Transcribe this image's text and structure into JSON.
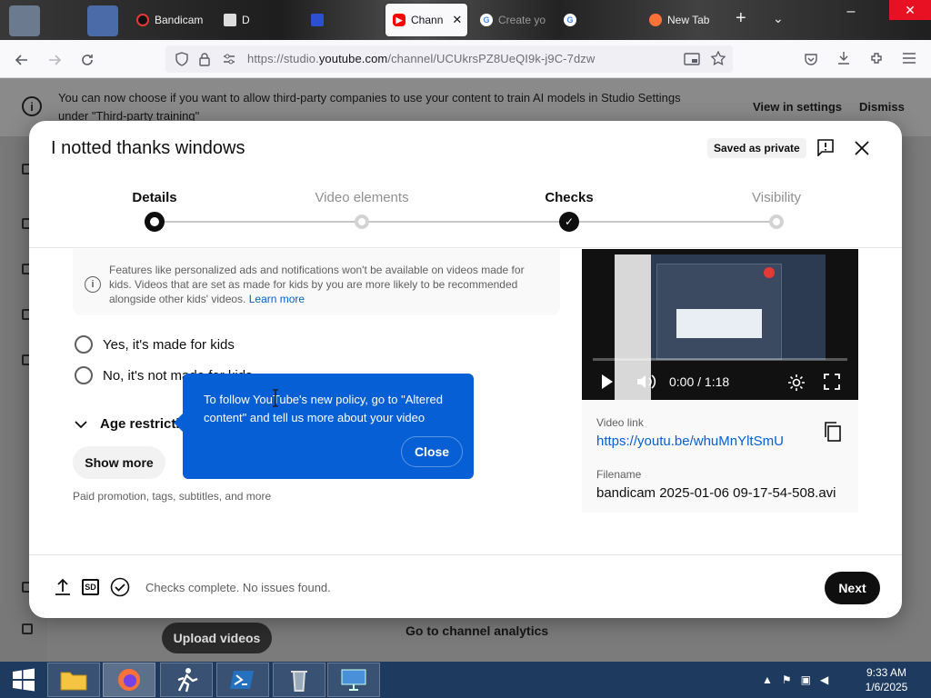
{
  "browser": {
    "tabs": [
      {
        "label": "Bandicam",
        "icon": "bandicam-icon"
      },
      {
        "label": "D",
        "icon": "document-icon"
      },
      {
        "label": "",
        "icon": "app-icon"
      },
      {
        "label": "Chann",
        "icon": "youtube-icon",
        "active": true
      },
      {
        "label": "Create yo",
        "icon": "google-icon"
      },
      {
        "label": "",
        "icon": "google-icon"
      },
      {
        "label": "New Tab",
        "icon": "firefox-icon"
      }
    ],
    "new_tab_symbol": "+",
    "tab_close_symbol": "✕",
    "url_prefix": "https://studio.",
    "url_domain": "youtube.com",
    "url_path": "/channel/UCUkrsPZ8UeQI9k-j9C-7dzw"
  },
  "page": {
    "banner_text": "You can now choose if you want to allow third-party companies to use your content to train AI models in Studio Settings under \"Third-party training\"",
    "banner_view": "View in settings",
    "banner_dismiss": "Dismiss",
    "upload_videos": "Upload videos",
    "channel_analytics": "Go to channel analytics"
  },
  "modal": {
    "title": "I notted thanks windows",
    "saved_badge": "Saved as private",
    "steps": [
      {
        "label": "Details",
        "state": "current"
      },
      {
        "label": "Video elements",
        "state": "todo"
      },
      {
        "label": "Checks",
        "state": "checked"
      },
      {
        "label": "Visibility",
        "state": "todo"
      }
    ],
    "kids_info": "Features like personalized ads and notifications won't be available on videos made for kids. Videos that are set as made for kids by you are more likely to be recommended alongside other kids' videos.",
    "learn_more": "Learn more",
    "radio_yes": "Yes, it's made for kids",
    "radio_no": "No, it's not made for kids",
    "age_restriction": "Age restriction",
    "show_more": "Show more",
    "paid_promotion": "Paid promotion, tags, subtitles, and more",
    "tooltip_text": "To follow YouTube's new policy, go to \"Altered content\" and tell us more about your video",
    "tooltip_close": "Close",
    "video_time": "0:00 / 1:18",
    "video_link_label": "Video link",
    "video_link": "https://youtu.be/whuMnYltSmU",
    "filename_label": "Filename",
    "filename": "bandicam 2025-01-06 09-17-54-508.avi",
    "checks_status": "Checks complete. No issues found.",
    "next": "Next",
    "sd_label": "SD"
  },
  "taskbar": {
    "time": "9:33 AM",
    "date": "1/6/2025"
  },
  "colors": {
    "accent_blue": "#065fd4",
    "close_red": "#e81123",
    "taskbar": "#1e3a5f"
  }
}
